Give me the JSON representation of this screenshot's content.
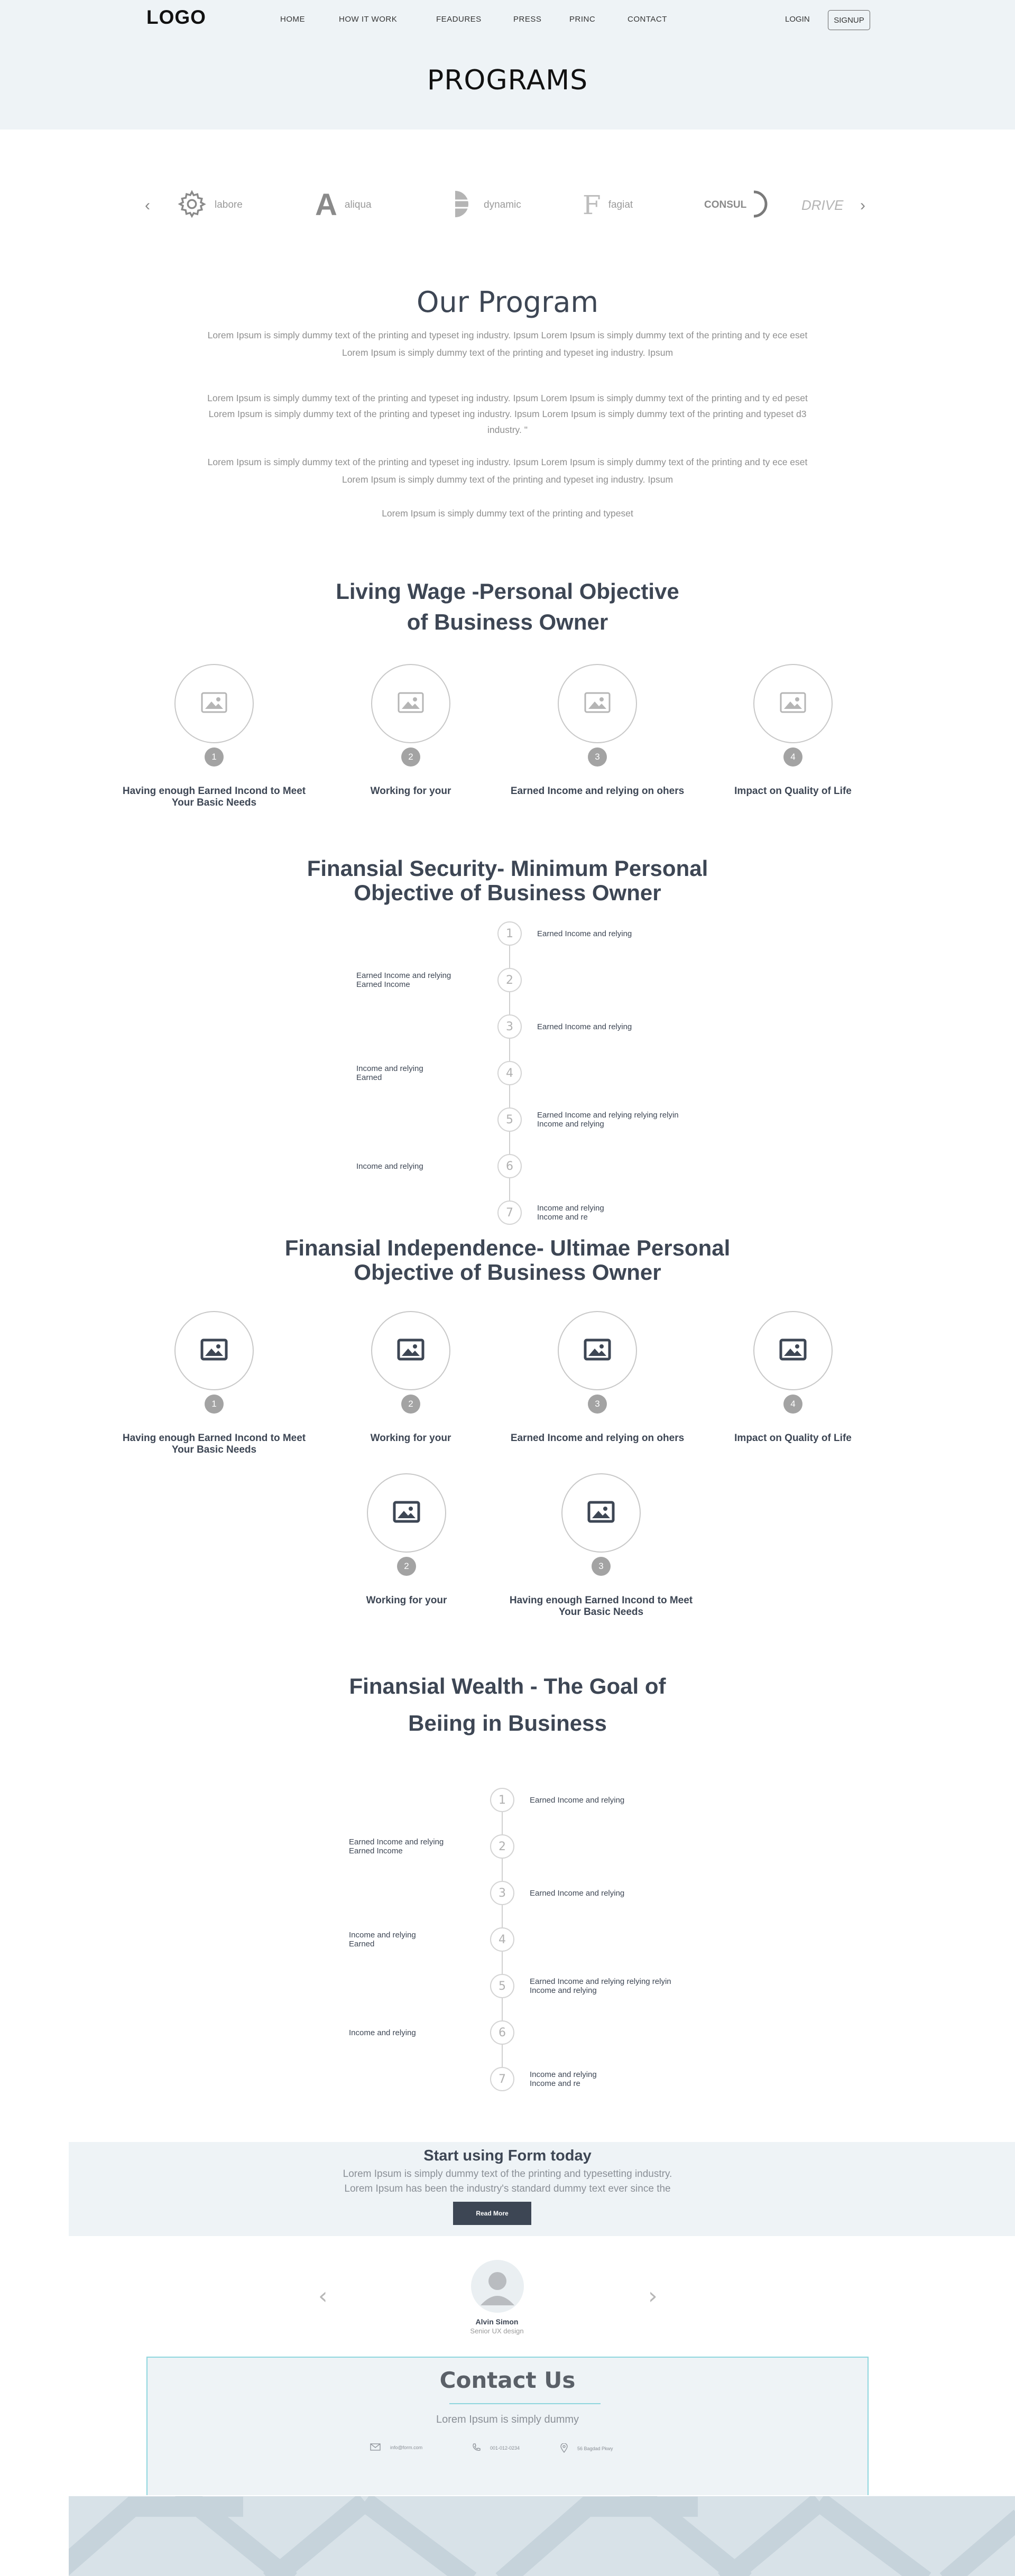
{
  "header": {
    "logo": "LOGO",
    "nav": [
      "HOME",
      "HOW IT WORK",
      "FEADURES",
      "PRESS",
      "PRINC",
      "CONTACT"
    ],
    "login": "LOGIN",
    "signup": "SIGNUP",
    "page_title": "PROGRAMS"
  },
  "brands": {
    "prev_icon": "chevron-left-icon",
    "next_icon": "chevron-right-icon",
    "items": [
      {
        "name": "labore",
        "icon": "gear-icon"
      },
      {
        "name": "aliqua",
        "icon": "letter-a-icon"
      },
      {
        "name": "dynamic",
        "icon": "half-disc-icon"
      },
      {
        "name": "fagiat",
        "icon": "letter-f-icon"
      },
      {
        "name": "CONSUL",
        "icon": "arc-icon"
      },
      {
        "name": "DRIVE",
        "icon": ""
      }
    ]
  },
  "our_program": {
    "title": "Our Program",
    "paragraphs": [
      [
        "Lorem Ipsum is simply dummy text of the printing and typeset  ing      industry.     Ipsum  Lorem Ipsum is simply dummy text of the printing and ty ece eset",
        "Lorem Ipsum is simply dummy text of the printing and typeset  ing      industry.     Ipsum"
      ],
      [
        "Lorem Ipsum is simply dummy text of the printing and typeset  ing      industry.     Ipsum  Lorem Ipsum is simply dummy text of the printing and ty ed peset",
        "Lorem Ipsum is simply dummy text of the printing and typeset  ing      industry.     Ipsum  Lorem Ipsum is simply dummy text of the printing and typeset d3",
        "industry.          \"",
        ""
      ],
      [
        "Lorem Ipsum is simply dummy text of the printing and typeset  ing      industry.     Ipsum  Lorem Ipsum is simply dummy text of the printing and ty ece eset",
        "Lorem Ipsum is simply dummy text of the printing and typeset  ing      industry.     Ipsum"
      ],
      [
        "Lorem Ipsum is simply dummy text of the printing and typeset"
      ]
    ]
  },
  "living_wage": {
    "title_line1": "Living Wage -Personal Objective",
    "title_line2": "of Business Owner",
    "items": [
      {
        "num": "1",
        "label": "Having enough Earned Incond to Meet Your Basic Needs"
      },
      {
        "num": "2",
        "label": "Working for your"
      },
      {
        "num": "3",
        "label": "Earned Income and relying on ohers"
      },
      {
        "num": "4",
        "label": "Impact on Quality of Life"
      }
    ]
  },
  "security": {
    "title_line1": "Finansial Security- Minimum Personal",
    "title_line2": "Objective of Business Owner",
    "steps": [
      {
        "num": "1",
        "side": "right",
        "text": "Earned Income and relying"
      },
      {
        "num": "2",
        "side": "left",
        "text": "Earned Income and relying\nEarned Income"
      },
      {
        "num": "3",
        "side": "right",
        "text": "Earned Income and relying"
      },
      {
        "num": "4",
        "side": "left",
        "text": "Income and relying\nEarned"
      },
      {
        "num": "5",
        "side": "right",
        "text": "Earned Income and relying relying relyin\nIncome and relying"
      },
      {
        "num": "6",
        "side": "left",
        "text": "Income and relying"
      },
      {
        "num": "7",
        "side": "right",
        "text": "Income and relying\n   Income and re"
      }
    ]
  },
  "independence": {
    "title_line1": "Finansial Independence- Ultimae Personal",
    "title_line2": "Objective of Business Owner",
    "items": [
      {
        "num": "1",
        "label": "Having enough Earned Incond to Meet Your Basic Needs"
      },
      {
        "num": "2",
        "label": "Working for your"
      },
      {
        "num": "3",
        "label": "Earned Income and relying on ohers"
      },
      {
        "num": "4",
        "label": "Impact on Quality of Life"
      },
      {
        "num": "2",
        "label": "Working for your"
      },
      {
        "num": "3",
        "label": "Having enough Earned Incond to Meet Your Basic Needs"
      }
    ]
  },
  "wealth": {
    "title_line1": "Finansial Wealth - The Goal of",
    "title_line2": "Beiing in Business",
    "steps": [
      {
        "num": "1",
        "side": "right",
        "text": "Earned Income and relying"
      },
      {
        "num": "2",
        "side": "left",
        "text": "Earned Income and relying\nEarned Income"
      },
      {
        "num": "3",
        "side": "right",
        "text": "Earned Income and relying"
      },
      {
        "num": "4",
        "side": "left",
        "text": "Income and relying\nEarned"
      },
      {
        "num": "5",
        "side": "right",
        "text": "Earned Income and relying relying relyin\nIncome and relying"
      },
      {
        "num": "6",
        "side": "left",
        "text": "Income and relying"
      },
      {
        "num": "7",
        "side": "right",
        "text": "Income and relying\n   Income and re"
      }
    ]
  },
  "cta": {
    "title": "Start using Form today",
    "line1": "Lorem Ipsum is simply dummy text of the printing and typesetting industry.",
    "line2": "Lorem Ipsum has been the industry's standard dummy text ever since the",
    "button": "Read More"
  },
  "testimonial": {
    "name": "Alvin Simon",
    "role": "Senior UX design"
  },
  "contact": {
    "title": "Contact Us",
    "subtitle": "Lorem Ipsum is simply dummy",
    "email": "info@form.com",
    "phone": "001-012-0234",
    "address": "56 Bagdad Pkwy"
  },
  "colors": {
    "hero_bg": "#eef3f6",
    "heading": "#3d4654",
    "accent": "#8ed6de",
    "button": "#3d4654"
  }
}
